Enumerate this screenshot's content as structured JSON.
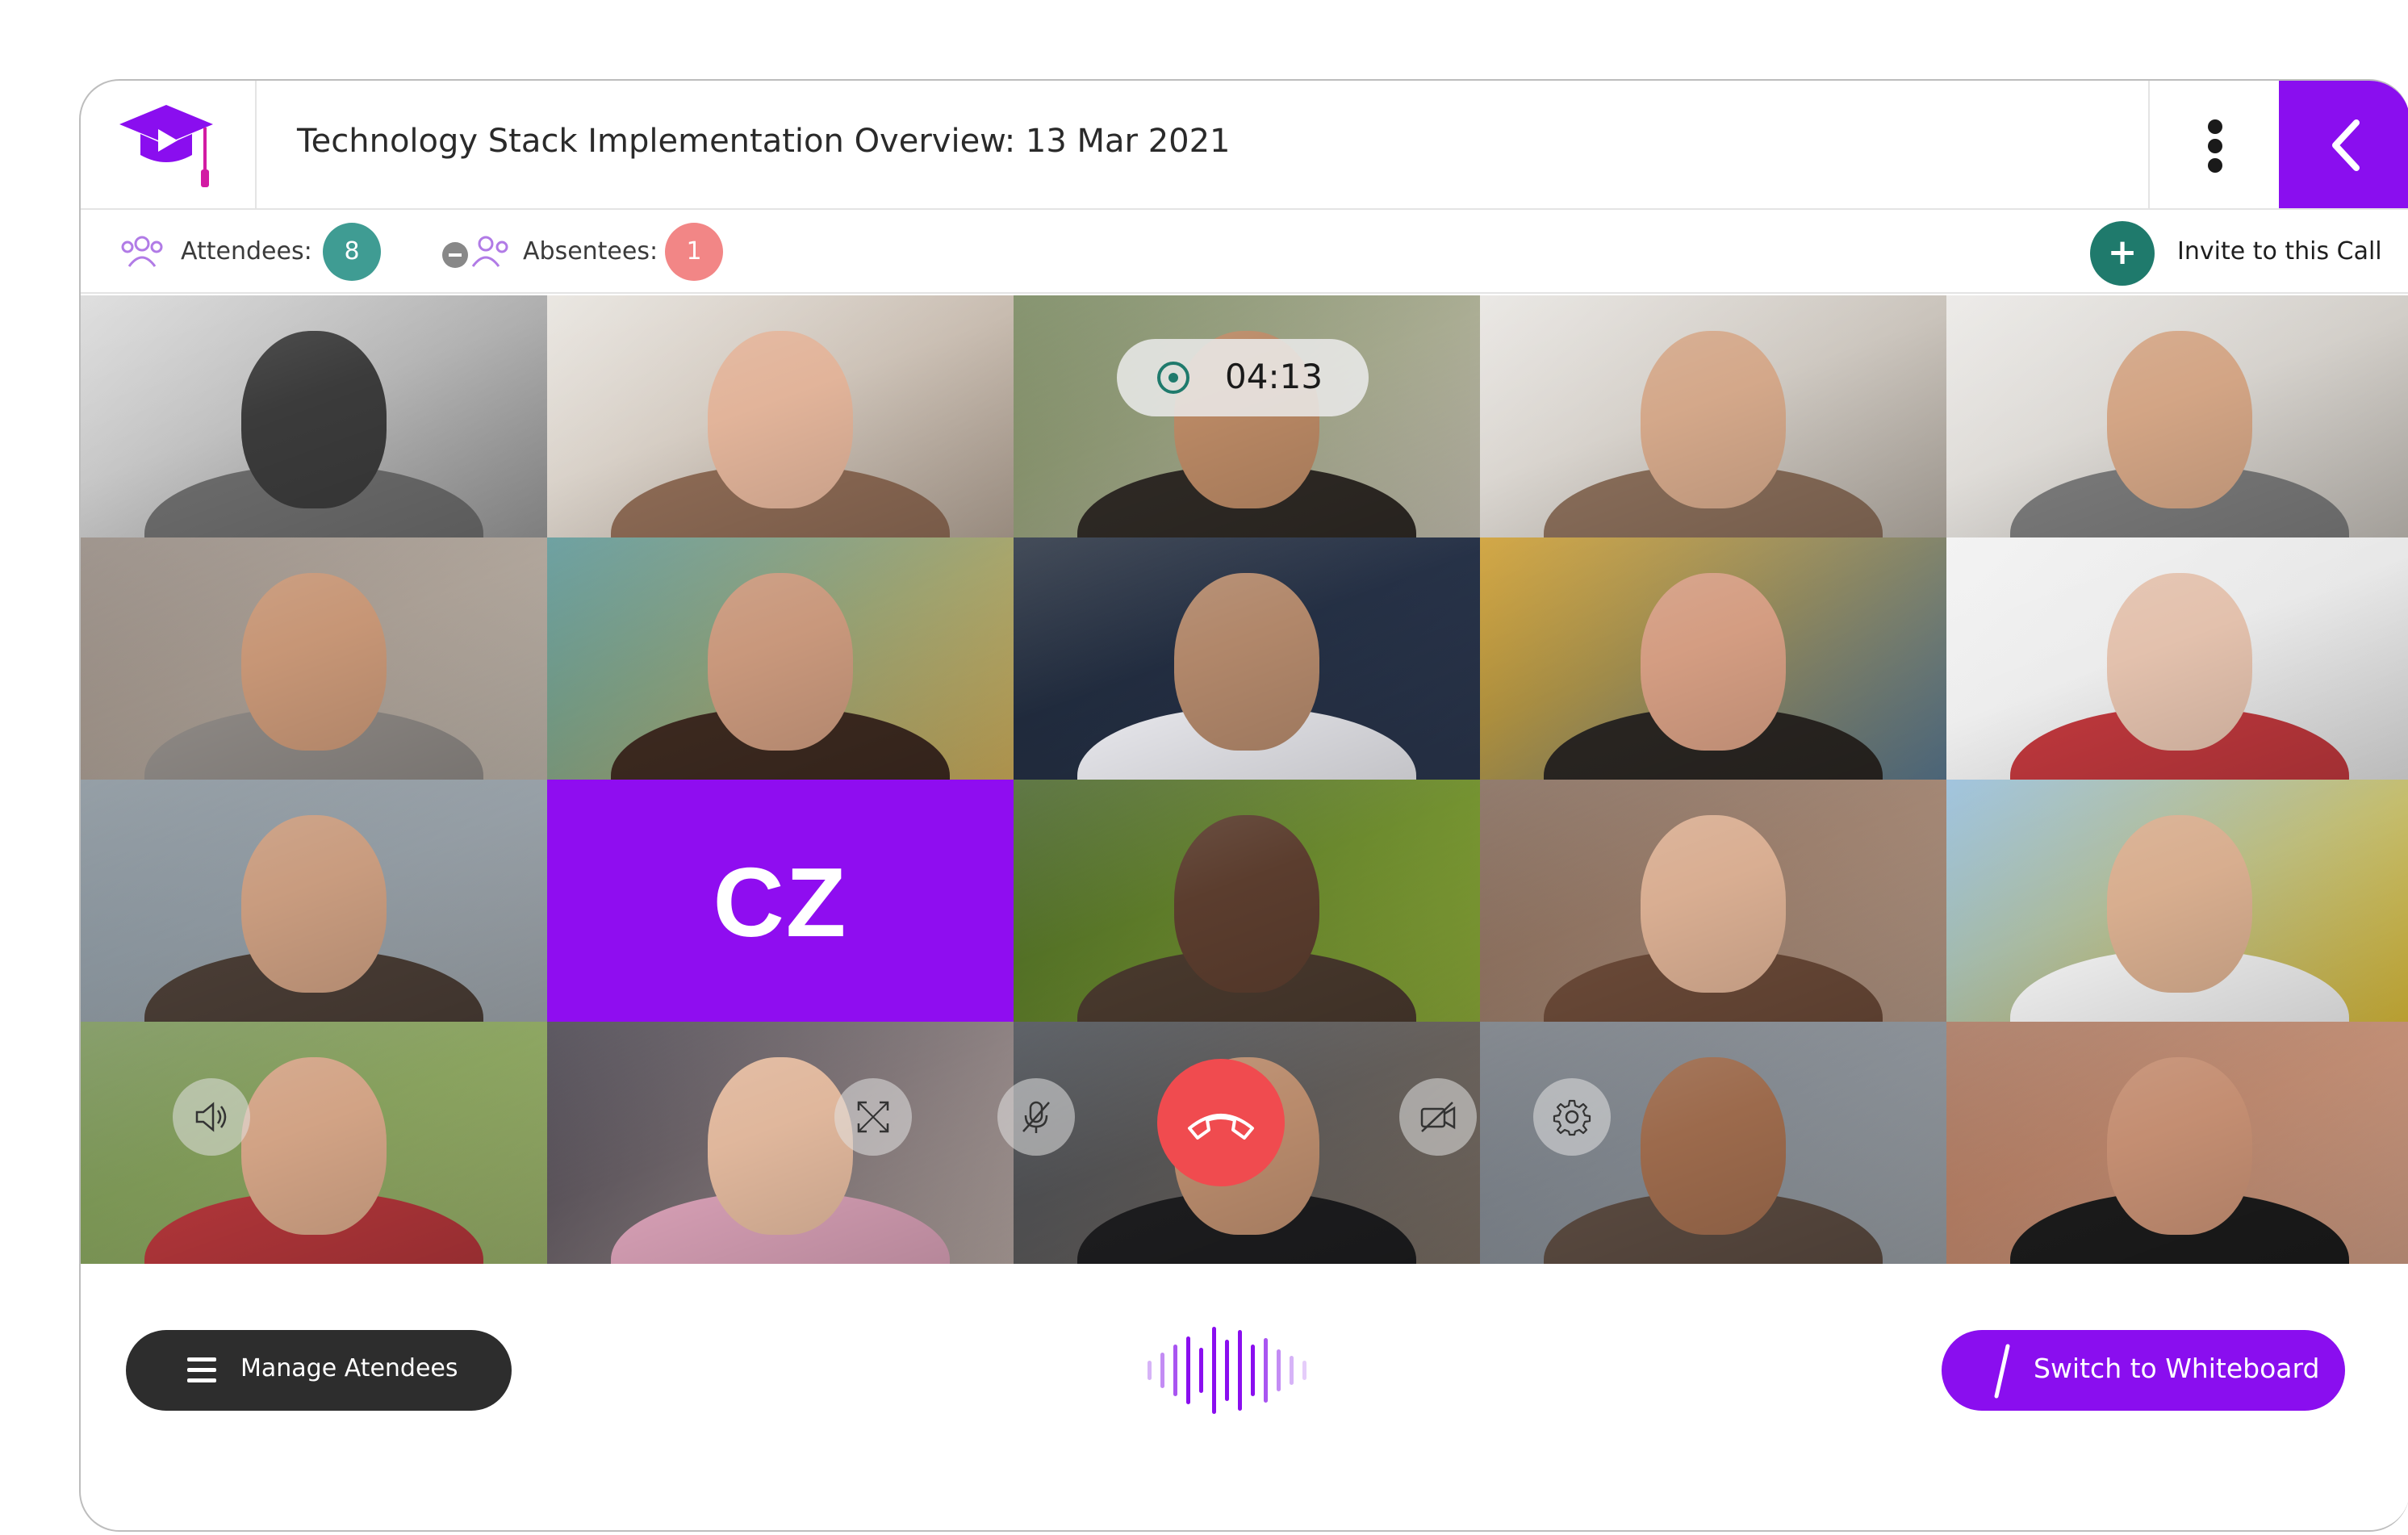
{
  "header": {
    "title": "Technology Stack Implementation Overview: 13 Mar 2021"
  },
  "info": {
    "attendees_label": "Attendees:",
    "attendees_count": "8",
    "absentees_label": "Absentees:",
    "absentees_count": "1",
    "invite_label": "Invite to this Call"
  },
  "call": {
    "timer": "04:13",
    "initials_tile": "CZ"
  },
  "footer": {
    "manage_label": "Manage Atendees",
    "whiteboard_label": "Switch to Whiteboard"
  },
  "colors": {
    "accent": "#8a0eef",
    "teal": "#1f7a6c",
    "absentee_badge": "#f28686",
    "attendee_badge": "#3f9c93",
    "hangup": "#f04b4f"
  },
  "icons": {
    "logo": "graduation-cap-play-icon",
    "more": "vertical-dots-icon",
    "back": "chevron-left-icon",
    "attendees": "people-icon",
    "absentees": "people-minus-icon",
    "invite": "plus-icon",
    "volume": "speaker-icon",
    "fullscreen": "expand-icon",
    "mic": "mic-off-icon",
    "hangup": "phone-hangup-icon",
    "camera": "camera-off-icon",
    "settings": "gear-icon",
    "manage": "menu-icon",
    "whiteboard": "pen-icon",
    "audio": "audio-wave-icon"
  }
}
